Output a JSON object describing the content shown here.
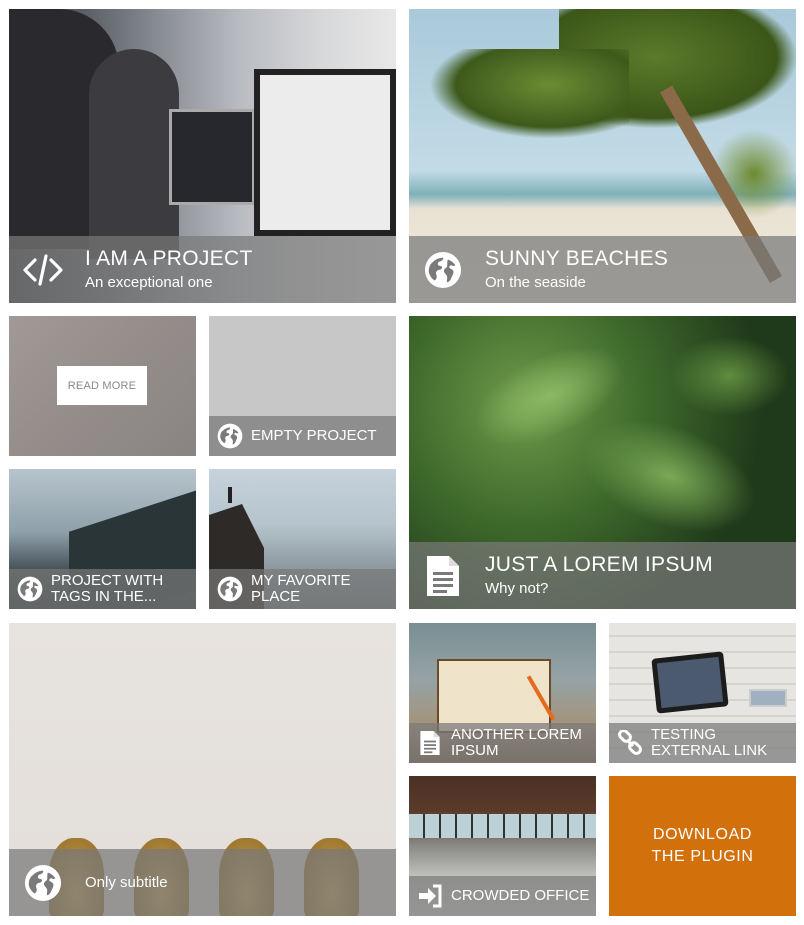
{
  "colors": {
    "caption_bg": "#7a7a7a",
    "accent": "#d2700b",
    "tile_placeholder": "#c7c7c7"
  },
  "tiles": {
    "project": {
      "title": "I AM A PROJECT",
      "subtitle": "An exceptional one",
      "icon": "code-icon"
    },
    "beaches": {
      "title": "SUNNY BEACHES",
      "subtitle": "On the seaside",
      "icon": "globe-icon"
    },
    "readmore": {
      "button": "READ MORE"
    },
    "empty": {
      "title": "EMPTY PROJECT",
      "icon": "globe-icon"
    },
    "lorem": {
      "title": "JUST A LOREM IPSUM",
      "subtitle": "Why not?",
      "icon": "document-icon"
    },
    "tags": {
      "title_line1": "PROJECT WITH",
      "title_line2": "TAGS IN THE...",
      "icon": "globe-icon"
    },
    "favorite": {
      "title_line1": "MY FAVORITE",
      "title_line2": "PLACE",
      "icon": "globe-icon"
    },
    "subtitle_only": {
      "subtitle": "Only subtitle",
      "icon": "globe-icon"
    },
    "another": {
      "title_line1": "ANOTHER LOREM",
      "title_line2": "IPSUM",
      "icon": "document-icon"
    },
    "external": {
      "title_line1": "TESTING",
      "title_line2": "EXTERNAL LINK",
      "icon": "link-icon"
    },
    "office": {
      "title": "CROWDED OFFICE",
      "icon": "sign-in-icon"
    },
    "download": {
      "line1": "DOWNLOAD",
      "line2": "THE PLUGIN"
    }
  }
}
